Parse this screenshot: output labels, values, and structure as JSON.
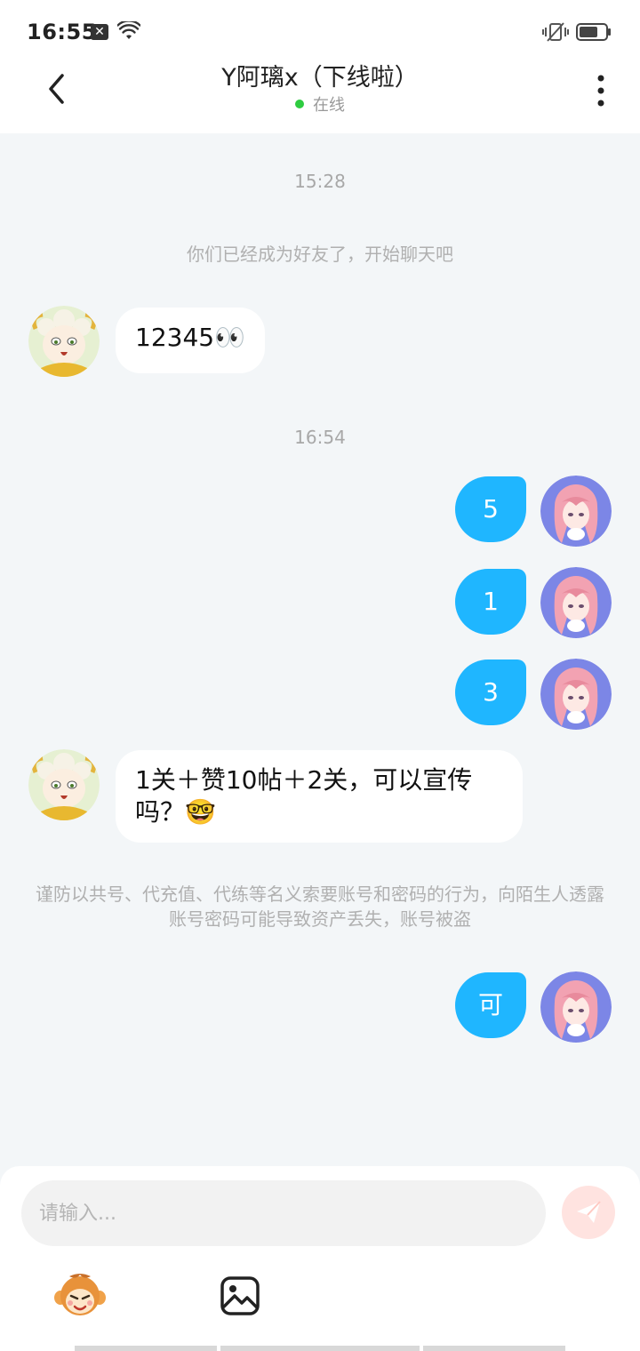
{
  "status_bar": {
    "time": "16:55",
    "notification_glyph": "✕"
  },
  "header": {
    "title": "Y阿璃x（下线啦）",
    "status": "在线",
    "status_color": "#2ecc40"
  },
  "chat": {
    "timestamp_1": "15:28",
    "system_friend": "你们已经成为好友了，开始聊天吧",
    "msg_in_1": "12345👀",
    "timestamp_2": "16:54",
    "msg_out_1": "5",
    "msg_out_2": "1",
    "msg_out_3": "3",
    "msg_in_2": "1关＋赞10帖＋2关，可以宣传吗？🤓",
    "system_warning": "谨防以共号、代充值、代练等名义索要账号和密码的行为，向陌生人透露账号密码可能导致资产丢失，账号被盗",
    "msg_out_4": "可",
    "bubble_out_color": "#1fb6ff"
  },
  "input": {
    "placeholder": "请输入...",
    "send_icon": "paper-plane-icon",
    "emoji_icon": "monkey-sticker-icon",
    "image_icon": "image-icon"
  }
}
